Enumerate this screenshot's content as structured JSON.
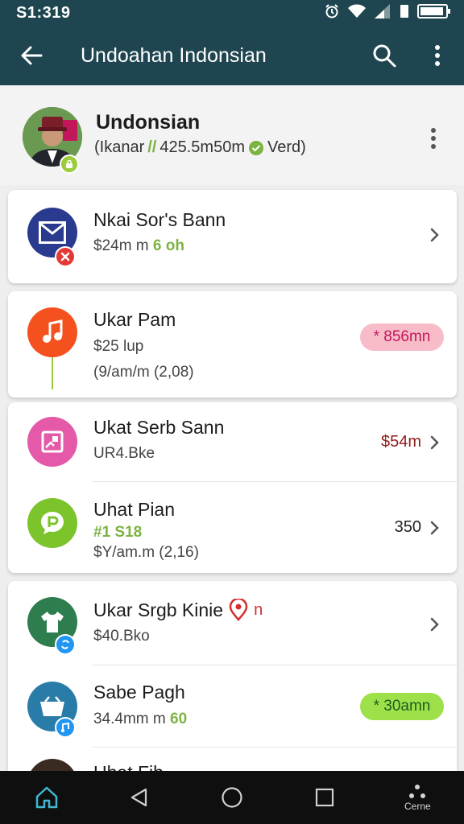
{
  "status_bar": {
    "time": "S1:319"
  },
  "app_bar": {
    "title": "Undoahan Indonsian"
  },
  "profile": {
    "name": "Undonsian",
    "sub_start": "(Ikanar",
    "sub_accent": "//",
    "sub_mid": "425.5m50m",
    "sub_end": "Verd)",
    "avatar_badge_color": "#9ccc3c"
  },
  "rows": [
    {
      "title": "Nkai Sor's Bann",
      "sub1": "$24m m",
      "sub1_accent": "6 oh",
      "icon": "envelope-icon",
      "icon_color": "#2a3b8f",
      "badge_color": "#e53935"
    },
    {
      "title": "Ukar Pam",
      "sub1": "$25 lup",
      "sub2": "(9/am/m (2,08)",
      "pill": "* 856mn",
      "icon": "music-note-icon",
      "icon_color": "#f4511e"
    },
    {
      "title": "Ukat Serb Sann",
      "sub1": "UR4.Bke",
      "value": "$54m",
      "icon": "image-frame-icon",
      "icon_color": "#e45aa8"
    },
    {
      "title": "Uhat Pian",
      "sub1_accent": "#1 S18",
      "sub2": "$Y/am.m (2,16)",
      "value": "350",
      "icon": "chat-bubble-icon",
      "icon_color": "#7cc42c"
    },
    {
      "title": "Ukar Srgb Kinie",
      "title_tail": "n",
      "sub1": "$40.Bko",
      "icon": "shirt-icon",
      "icon_color": "#2e7d4f",
      "badge_color": "#2196f3"
    },
    {
      "title": "Sabe Pagh",
      "sub1": "34.4mm m",
      "sub1_accent": "60",
      "pill": "* 30amn",
      "icon": "basket-icon",
      "icon_color": "#2a7ca8",
      "badge_color": "#2196f3"
    },
    {
      "title": "Uhat Fib"
    }
  ],
  "nav": {
    "recents_label": "Cerne"
  },
  "colors": {
    "app_bar": "#1f4650",
    "accent_green": "#7cb342",
    "pill_pink_bg": "#f8bcc9",
    "pill_pink_text": "#c2185b",
    "pill_green_bg": "#9ee04a",
    "pill_green_text": "#1b5e20",
    "value_red": "#8e1b1b"
  }
}
